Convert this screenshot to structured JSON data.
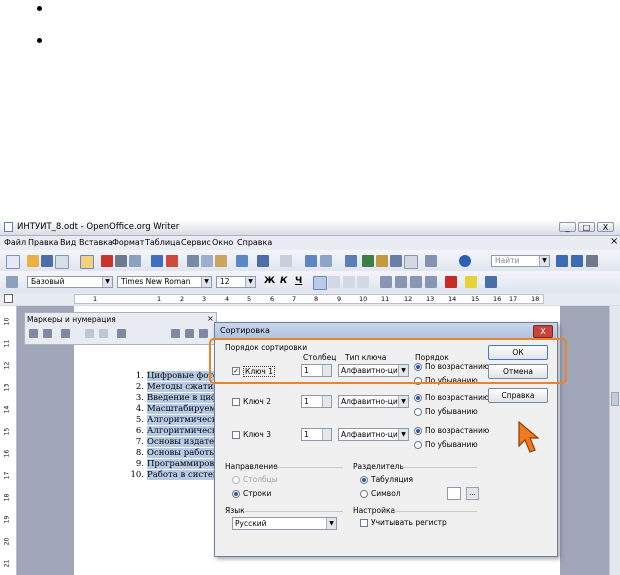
{
  "window": {
    "title": "ИНТУИТ_8.odt - OpenOffice.org Writer",
    "controls": [
      "_",
      "□",
      "X"
    ]
  },
  "menu": [
    "Файл",
    "Правка",
    "Вид",
    "Вставка",
    "Формат",
    "Таблица",
    "Сервис",
    "Окно",
    "Справка"
  ],
  "menu_close": "×",
  "toolbar": {
    "find_placeholder": "Найти",
    "style": "Базовый",
    "font": "Times New Roman",
    "size": "12",
    "bold": "Ж",
    "italic": "К",
    "underline": "Ч"
  },
  "ruler": [
    "1",
    "1",
    "2",
    "3",
    "4",
    "5",
    "6",
    "7",
    "8",
    "9",
    "10",
    "11",
    "12",
    "13",
    "14",
    "15",
    "16",
    "17",
    "18"
  ],
  "vruler": [
    "10",
    "11",
    "12",
    "13",
    "14",
    "15",
    "16",
    "17",
    "18",
    "19",
    "20",
    "21"
  ],
  "panel_title": "Маркеры и нумерация",
  "doc_list": [
    {
      "n": "1.",
      "t": "Цифровые фото"
    },
    {
      "n": "2.",
      "t": "Методы сжатия"
    },
    {
      "n": "3.",
      "t": "Введение в циф"
    },
    {
      "n": "4.",
      "t": "Масштабируема"
    },
    {
      "n": "5.",
      "t": "Алгоритмическ"
    },
    {
      "n": "6.",
      "t": "Алгоритмическ"
    },
    {
      "n": "7.",
      "t": "Основы издател"
    },
    {
      "n": "8.",
      "t": "Основы работы"
    },
    {
      "n": "9.",
      "t": "Программирова"
    },
    {
      "n": "10.",
      "t": "Работа в систем"
    }
  ],
  "dialog": {
    "title": "Сортировка",
    "close": "X",
    "order_group": "Порядок сортировки",
    "col_header": "Столбец",
    "keytype_header": "Тип ключа",
    "order_header": "Порядок",
    "keys": [
      {
        "label": "Ключ 1",
        "checked": true,
        "column": "1",
        "type": "Алфавитно-цифр",
        "asc": "По возрастанию",
        "desc": "По убыванию"
      },
      {
        "label": "Ключ 2",
        "checked": false,
        "column": "1",
        "type": "Алфавитно-цифр",
        "asc": "По возрастанию",
        "desc": "По убыванию"
      },
      {
        "label": "Ключ 3",
        "checked": false,
        "column": "1",
        "type": "Алфавитно-цифр",
        "asc": "По возрастанию",
        "desc": "По убыванию"
      }
    ],
    "direction_group": "Направление",
    "dir_columns": "Столбцы",
    "dir_rows": "Строки",
    "separator_group": "Разделитель",
    "sep_tab": "Табуляция",
    "sep_symbol": "Символ",
    "sep_more": "...",
    "language_group": "Язык",
    "language": "Русский",
    "settings_group": "Настройка",
    "match_case": "Учитывать регистр",
    "ok": "ОК",
    "cancel": "Отмена",
    "help": "Справка"
  },
  "colors": {
    "highlight_border": "#e8832e",
    "cursor": "#f07a1a",
    "selection": "#b8cbe6"
  }
}
